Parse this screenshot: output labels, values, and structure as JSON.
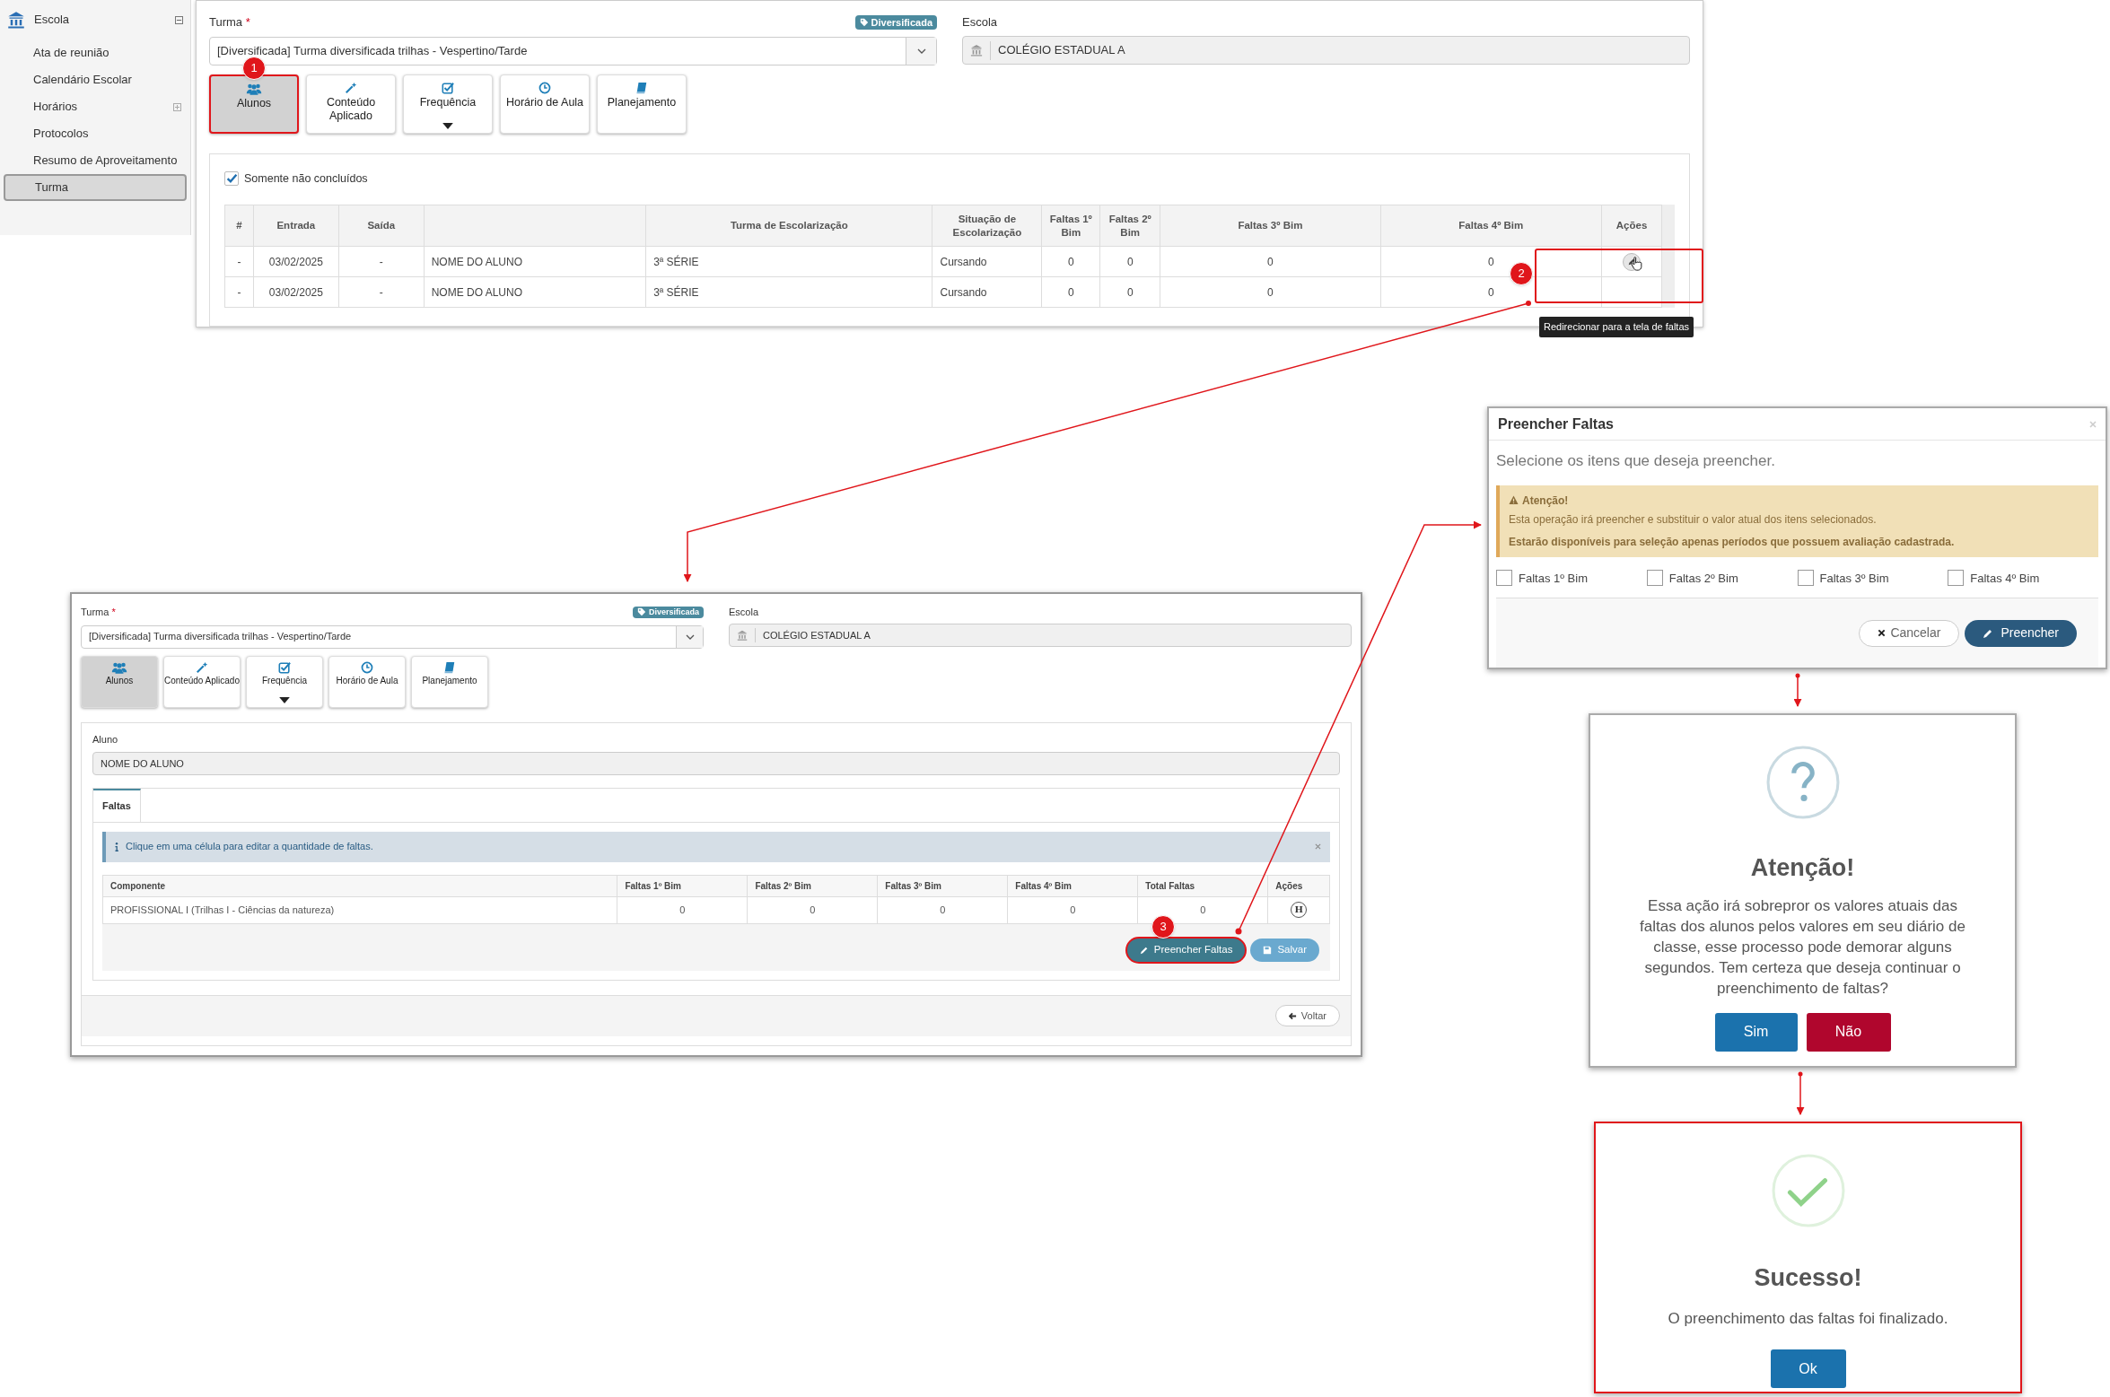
{
  "sidebar": {
    "title": "Escola",
    "expanded": true,
    "items": [
      {
        "label": "Ata de reunião",
        "selected": false
      },
      {
        "label": "Calendário Escolar",
        "selected": false
      },
      {
        "label": "Horários",
        "selected": false,
        "expandable": true
      },
      {
        "label": "Protocolos",
        "selected": false
      },
      {
        "label": "Resumo de Aproveitamento",
        "selected": false
      },
      {
        "label": "Turma",
        "selected": true
      }
    ]
  },
  "class_form": {
    "turma_label": "Turma",
    "required_mark": "*",
    "badge": "Diversificada",
    "turma_value": "[Diversificada]  Turma diversificada trilhas - Vespertino/Tarde",
    "escola_label": "Escola",
    "escola_value": "COLÉGIO ESTADUAL A",
    "toolbar": [
      {
        "label": "Alunos",
        "selected": true,
        "highlighted": true
      },
      {
        "label": "Conteúdo Aplicado",
        "selected": false,
        "highlighted": false
      },
      {
        "label": "Frequência",
        "selected": false,
        "highlighted": false,
        "dropdown": true
      },
      {
        "label": "Horário de Aula",
        "selected": false,
        "highlighted": false
      },
      {
        "label": "Planejamento",
        "selected": false,
        "highlighted": false
      }
    ],
    "filter": {
      "label": "Somente não concluídos",
      "checked": true
    },
    "table": {
      "columns": [
        {
          "label": "#"
        },
        {
          "label": "Entrada"
        },
        {
          "label": "Saída"
        },
        {},
        {
          "label": "Turma de Escolarização"
        },
        {
          "label": "Situação de Escolarização"
        },
        {
          "label": "Faltas 1º Bim"
        },
        {
          "label": "Faltas 2º Bim"
        },
        {
          "label": "Faltas 3º Bim"
        },
        {
          "label": "Faltas 4º Bim"
        },
        {
          "label": "Ações"
        }
      ],
      "rows": [
        {
          "cells": [
            "-",
            "03/02/2025",
            "-",
            "NOME DO ALUNO",
            "3ª SÉRIE",
            "Cursando",
            "0",
            "0",
            "0",
            "0"
          ],
          "edit_button": true
        },
        {
          "cells": [
            "-",
            "03/02/2025",
            "-",
            "NOME DO ALUNO",
            "3ª SÉRIE",
            "Cursando",
            "0",
            "0",
            "0",
            "0"
          ],
          "edit_button": false
        }
      ],
      "tooltip": "Redirecionar para a tela de faltas"
    }
  },
  "student_form": {
    "turma_label": "Turma",
    "required_mark": "*",
    "badge": "Diversificada",
    "turma_value": "[Diversificada]  Turma diversificada trilhas - Vespertino/Tarde",
    "escola_label": "Escola",
    "escola_value": "COLÉGIO ESTADUAL A",
    "toolbar": [
      {
        "label": "Alunos",
        "selected": true,
        "highlighted": false
      },
      {
        "label": "Conteúdo Aplicado",
        "selected": false,
        "highlighted": false
      },
      {
        "label": "Frequência",
        "selected": false,
        "highlighted": false,
        "dropdown": true
      },
      {
        "label": "Horário de Aula",
        "selected": false,
        "highlighted": false
      },
      {
        "label": "Planejamento",
        "selected": false,
        "highlighted": false
      }
    ],
    "aluno_label": "Aluno",
    "aluno_value": "NOME DO ALUNO",
    "tabs": [
      {
        "label": "Faltas",
        "selected": true
      }
    ],
    "info": "Clique em uma célula para editar a quantidade de faltas.",
    "table": {
      "columns": [
        "Componente",
        "Faltas 1º Bim",
        "Faltas 2º Bim",
        "Faltas 3º Bim",
        "Faltas 4º Bim",
        "Total Faltas",
        "Ações"
      ],
      "rows": [
        {
          "cells": [
            "PROFISSIONAL I (Trilhas I - Ciências da natureza)",
            "0",
            "0",
            "0",
            "0",
            "0"
          ],
          "action": "H"
        }
      ]
    },
    "buttons": [
      {
        "label": "Preencher Faltas",
        "kind": "fill",
        "highlighted": true
      },
      {
        "label": "Salvar",
        "kind": "save",
        "highlighted": false
      }
    ],
    "back": "Voltar"
  },
  "fill_dialog": {
    "title": "Preencher Faltas",
    "subtitle": "Selecione os itens que deseja preencher.",
    "alert_title": "Atenção!",
    "alert_message": "Esta operação irá preencher e substituir o valor atual dos itens selecionados.",
    "alert_note": "Estarão disponíveis para seleção apenas períodos que possuem avaliação cadastrada.",
    "options": [
      {
        "label": "Faltas 1º Bim",
        "checked": false
      },
      {
        "label": "Faltas 2º Bim",
        "checked": false
      },
      {
        "label": "Faltas 3º Bim",
        "checked": false
      },
      {
        "label": "Faltas 4º Bim",
        "checked": false
      }
    ],
    "cancel": "Cancelar",
    "confirm": "Preencher"
  },
  "confirm_dialog": {
    "title": "Atenção!",
    "message": "Essa ação irá sobrepror os valores atuais das faltas dos alunos pelos valores em seu diário de classe, esse processo pode demorar alguns segundos. Tem certeza que deseja continuar o preenchimento de faltas?",
    "yes": "Sim",
    "no": "Não",
    "highlighted": false
  },
  "success_dialog": {
    "title": "Sucesso!",
    "message": "O preenchimento das faltas foi finalizado.",
    "ok": "Ok",
    "highlighted": true
  },
  "callouts": [
    {
      "label": "1"
    },
    {
      "label": "2"
    },
    {
      "label": "3"
    }
  ]
}
